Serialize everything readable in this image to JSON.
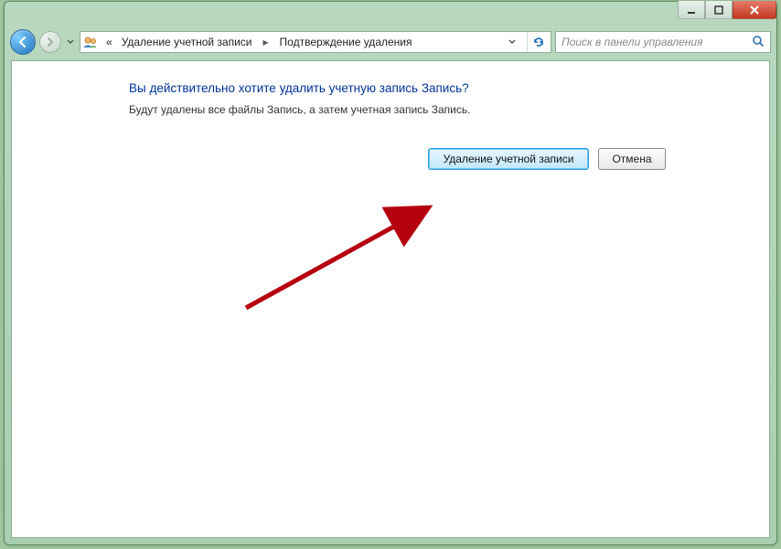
{
  "breadcrumb": {
    "prefix": "«",
    "seg1": "Удаление учетной записи",
    "seg2": "Подтверждение удаления"
  },
  "search": {
    "placeholder": "Поиск в панели управления"
  },
  "heading": "Вы действительно хотите удалить учетную запись Запись?",
  "subtext": "Будут удалены все файлы Запись, а затем учетная запись Запись.",
  "buttons": {
    "delete": "Удаление учетной записи",
    "cancel": "Отмена"
  }
}
